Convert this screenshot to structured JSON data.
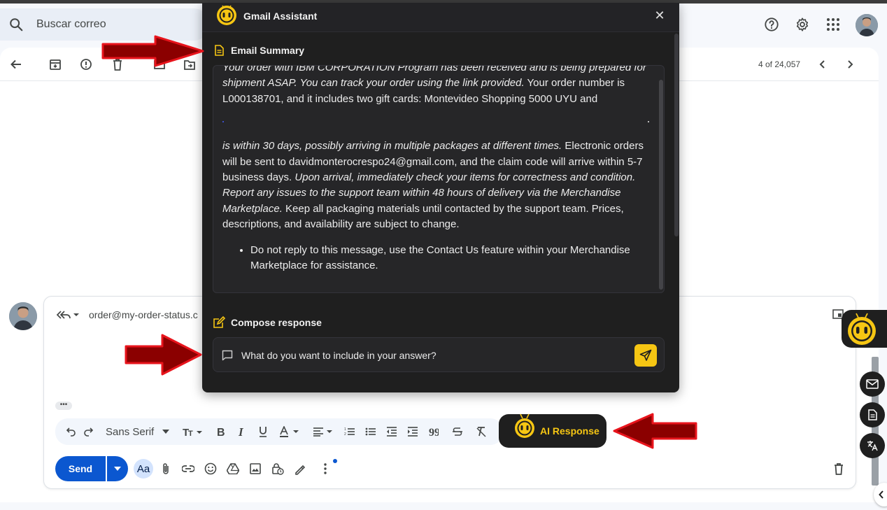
{
  "search": {
    "placeholder": "Buscar correo"
  },
  "mail_toolbar": {
    "pager": "4 of 24,057"
  },
  "reply": {
    "to_address": "order@my-order-status.c"
  },
  "assistant": {
    "title": "Gmail Assistant",
    "close_glyph": "✕",
    "summary_label": "Email Summary",
    "summary": {
      "line1_italic": "Your order with IBM CORPORATION Program has been received and is being prepared for shipment ASAP. You can track your order using the link provided.",
      "line1_rest": " Your order number is L000138701, and it includes two gift cards: Montevideo Shopping 5000 UYU and",
      "line2_italic": "is within 30 days, possibly arriving in multiple packages at different times.",
      "line2_rest": " Electronic orders will be sent to davidmonterocrespo24@gmail.com, and the claim code will arrive within 5-7 business days. ",
      "line3_italic": "Upon arrival, immediately check your items for correctness and condition. Report any issues to the support team within 48 hours of delivery via the Merchandise Marketplace.",
      "line3_rest": " Keep all packaging materials until contacted by the support team. Prices, descriptions, and availability are subject to change.",
      "bullet": "Do not reply to this message, use the Contact Us feature within your Merchandise Marketplace for assistance."
    },
    "compose_label": "Compose response",
    "prompt_placeholder": "What do you want to include in your answer?"
  },
  "ai_button": {
    "label": "AI Response"
  },
  "compose": {
    "send_label": "Send",
    "font_name": "Sans Serif",
    "aa_label": "Aa",
    "dots": "•••"
  },
  "colors": {
    "accent_yellow": "#f6c613",
    "assistant_bg": "#1f1f1f",
    "send_blue": "#0b57d0",
    "arrow_red": "#8b0000"
  }
}
